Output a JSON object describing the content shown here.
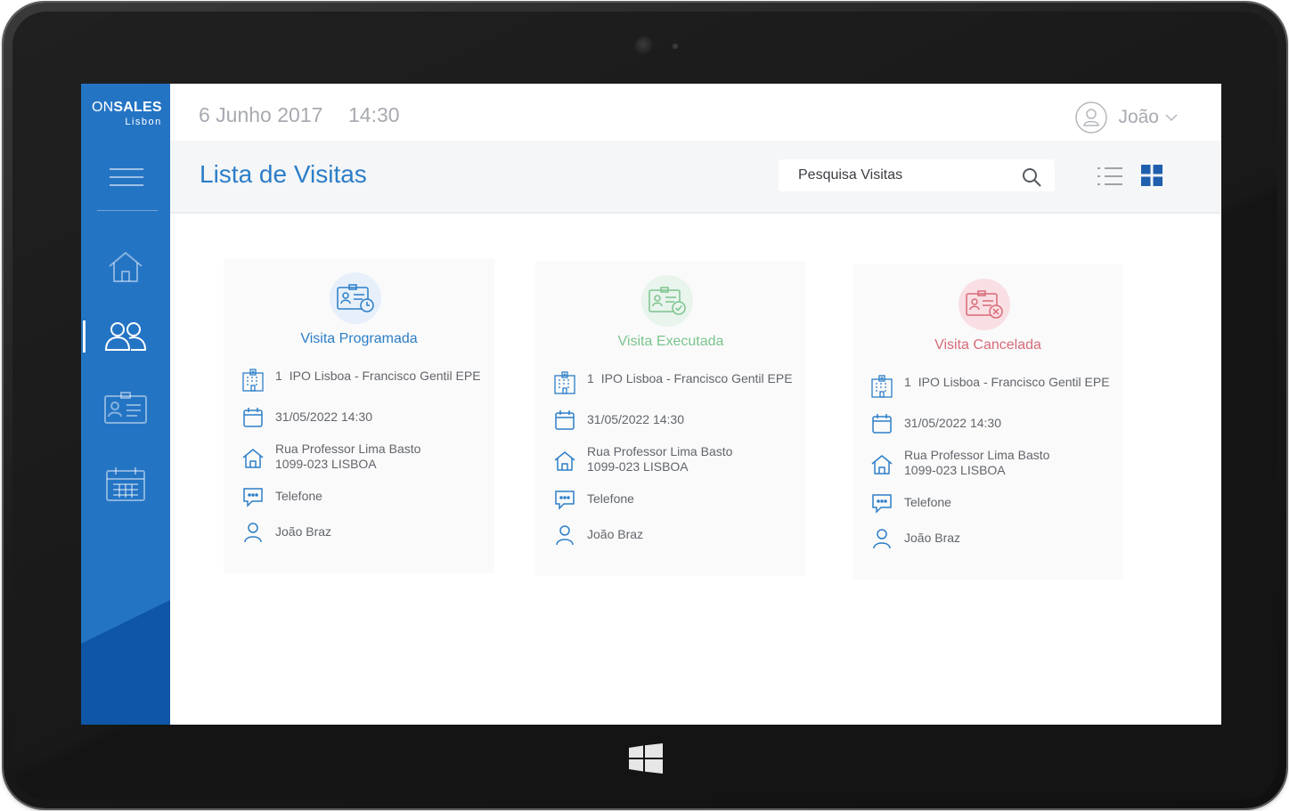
{
  "app": {
    "logo_on": "ON",
    "logo_sales": "SALES",
    "logo_city": "Lisbon"
  },
  "header": {
    "date": "6 Junho 2017",
    "time": "14:30",
    "user_name": "João"
  },
  "page": {
    "title": "Lista de Visitas",
    "search_placeholder": "Pesquisa Visitas"
  },
  "sidebar": {
    "items": [
      {
        "icon": "home-icon"
      },
      {
        "icon": "users-icon",
        "active": true
      },
      {
        "icon": "visit-card-icon"
      },
      {
        "icon": "calendar-grid-icon"
      }
    ]
  },
  "colors": {
    "accent": "#2474c4",
    "programada": "#2c7ec8",
    "executada": "#7cc48e",
    "cancelada": "#d86a78"
  },
  "cards": [
    {
      "status": "Visita Programada",
      "number": "1",
      "institution": "IPO Lisboa - Francisco Gentil EPE",
      "datetime": "31/05/2022 14:30",
      "address_line1": "Rua Professor Lima Basto",
      "address_line2": "1099-023 LISBOA",
      "contact": "Telefone",
      "person": "João Braz"
    },
    {
      "status": "Visita Executada",
      "number": "1",
      "institution": "IPO Lisboa - Francisco Gentil EPE",
      "datetime": "31/05/2022 14:30",
      "address_line1": "Rua Professor Lima Basto",
      "address_line2": "1099-023 LISBOA",
      "contact": "Telefone",
      "person": "João Braz"
    },
    {
      "status": "Visita Cancelada",
      "number": "1",
      "institution": "IPO Lisboa - Francisco Gentil EPE",
      "datetime": "31/05/2022 14:30",
      "address_line1": "Rua Professor Lima Basto",
      "address_line2": "1099-023 LISBOA",
      "contact": "Telefone",
      "person": "João Braz"
    }
  ]
}
